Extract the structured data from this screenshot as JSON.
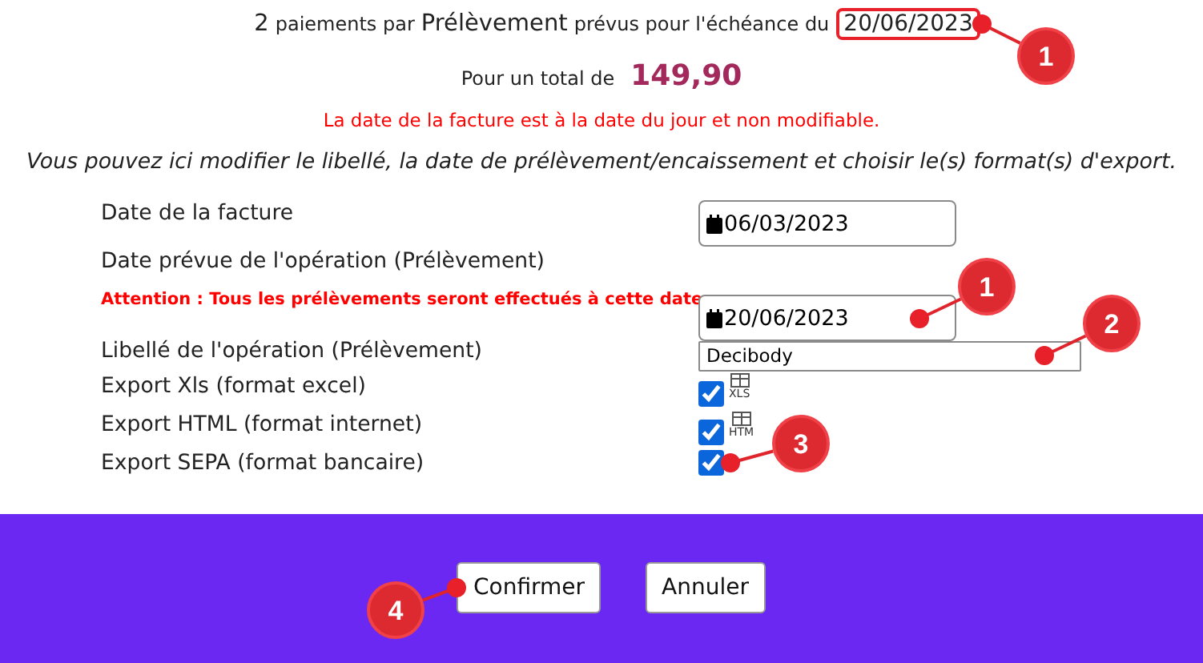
{
  "summary": {
    "count": "2",
    "text_before": "paiements par",
    "method": "Prélèvement",
    "text_after": "prévus pour l'échéance du",
    "due_date": {
      "value": "20/06/2023",
      "highlighted": true,
      "callout": {
        "number": "1"
      }
    }
  },
  "total": {
    "label": "Pour un total de",
    "amount": "149,90"
  },
  "warning": "La date de la facture est à la date du jour et non modifiable.",
  "intro": "Vous pouvez ici modifier le libellé, la date de prélèvement/encaissement et choisir le(s) format(s) d'export.",
  "fields": [
    {
      "kind": "date",
      "label": "Date de la facture",
      "value": "06/03/2023"
    },
    {
      "kind": "date",
      "label": "Date prévue de l'opération (Prélèvement)",
      "note": "Attention : Tous les prélèvements seront effectués à cette date",
      "value": "20/06/2023",
      "callout": {
        "number": "1"
      }
    },
    {
      "kind": "text",
      "label": "Libellé de l'opération (Prélèvement)",
      "value": "Decibody",
      "callout": {
        "number": "2"
      }
    },
    {
      "kind": "checkbox",
      "label": "Export Xls (format excel)",
      "checked": true,
      "format": "XLS"
    },
    {
      "kind": "checkbox",
      "label": "Export HTML (format internet)",
      "checked": true,
      "format": "HTM"
    },
    {
      "kind": "checkbox",
      "label": "Export SEPA (format bancaire)",
      "checked": true,
      "callout": {
        "number": "3"
      }
    }
  ],
  "buttons": [
    {
      "label": "Confirmer",
      "callout": {
        "number": "4"
      }
    },
    {
      "label": "Annuler"
    }
  ]
}
